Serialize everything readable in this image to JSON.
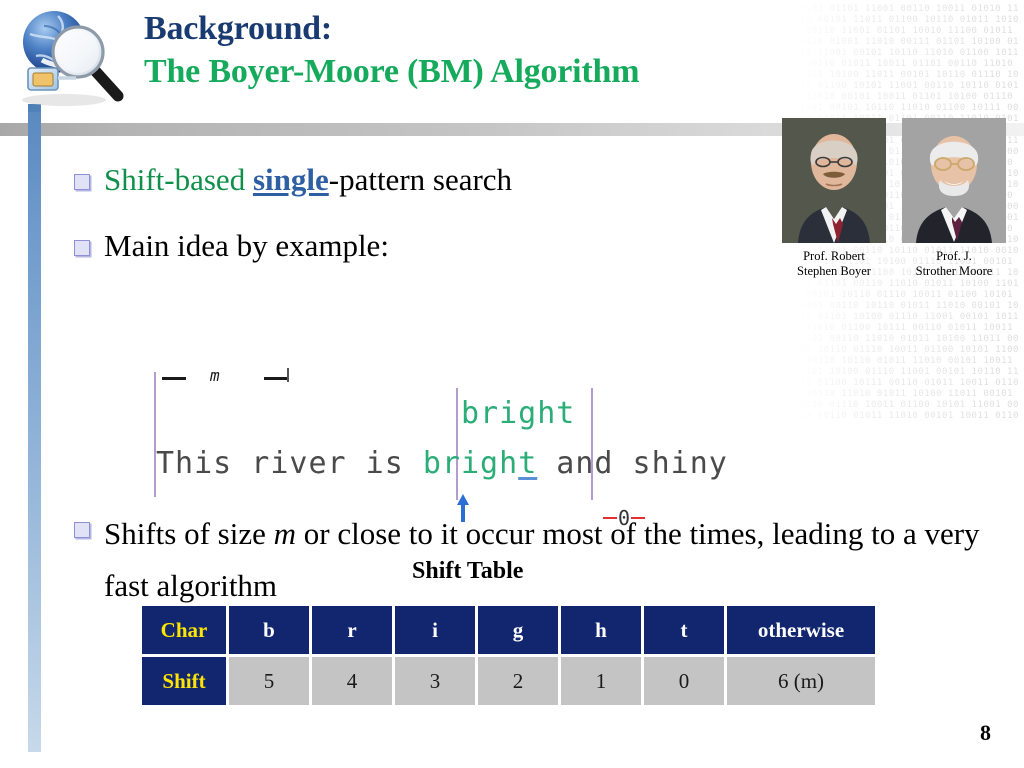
{
  "slide": {
    "title_line1": "Background:",
    "title_line2": "The Boyer-Moore (BM) Algorithm",
    "page_number": "8",
    "colors": {
      "title_dark_blue": "#1a3b72",
      "title_green": "#15aa5c",
      "bullet_green": "#0e8f4a",
      "link_blue": "#2e5fa3",
      "table_header_navy": "#11266e",
      "table_label_yellow": "#ffe400",
      "table_cell_gray": "#c4c4c4",
      "pattern_green": "#2bad78",
      "marker_purple": "#b49bd0",
      "arrow_blue": "#2b6fd6",
      "shift_red": "#e03030"
    }
  },
  "logo": {
    "name": "globe-magnifier-logo"
  },
  "bullets": [
    {
      "id": "bullet-shift-based",
      "parts": [
        {
          "text": "Shift-based ",
          "style": "green"
        },
        {
          "text": "single",
          "style": "link"
        },
        {
          "text": "-pattern search",
          "style": "plain"
        }
      ],
      "plain": "Shift-based single-pattern search"
    },
    {
      "id": "bullet-main-idea",
      "parts": [
        {
          "text": "Main idea by example:",
          "style": "plain"
        }
      ],
      "plain": "Main idea by example:"
    },
    {
      "id": "bullet-shifts-of-size",
      "parts": [
        {
          "text": "Shifts of size ",
          "style": "plain"
        },
        {
          "text": "m",
          "style": "italic"
        },
        {
          "text": " or close to it occur most of the times, leading to a very fast algorithm",
          "style": "plain"
        }
      ],
      "plain": "Shifts of size m or close to it occur most of the times, leading to a very fast algorithm"
    }
  ],
  "photos": [
    {
      "name": "photo-robert-boyer",
      "caption_line1": "Prof. Robert",
      "caption_line2": "Stephen Boyer"
    },
    {
      "name": "photo-j-strother-moore",
      "caption_line1": "Prof. J.",
      "caption_line2": "Strother Moore"
    }
  ],
  "example": {
    "text_prefix": "This river is ",
    "match_word": "bright",
    "match_last_char": "t",
    "text_suffix": " and shiny",
    "pattern_above": "bright",
    "span_label": "m",
    "shift_marker": "0",
    "text_full": "This river is bright and shiny"
  },
  "shift_table": {
    "label": "Shift Table",
    "row_headers": [
      "Char",
      "Shift"
    ],
    "chars": [
      "b",
      "r",
      "i",
      "g",
      "h",
      "t",
      "otherwise"
    ],
    "shifts": [
      "5",
      "4",
      "3",
      "2",
      "1",
      "0",
      "6 (m)"
    ]
  },
  "watermark": {
    "text": "10101 01101 11001 00110 10011 01010 11010 00101 11011 01100 10110 01011 10101 00110 11001 01101 10010 11100 01011 10110 01001 11010 00111 01101 10100 01110 11001 00101 10110 11010 01100 10111 00110 01011 10011 01101 00110 11010 01011 10100 11011 00101 10110 01110 10011 01100 10101 11001 00110 10110 01011 11010 00101 10011 01101 10100 01110 11001 00101 10110 11010 01100 10111 00110 01011 10011 01101 00110 11010 01011 10100 11011 00101 10110 01110 10011 01100 10101 11001 00110 10110 01011 11010 00101 10011 01101 10100 01110 11001 00101 10110 11010 01100 10111 00110 01011 10011 01101 00110 11010 01011 10100 11011 00101 10110 01110 10011 01100 10101 11001 00110 10110 01011 11010 00101 10011 01101 10100 01110 11001 00101 10110 11010 01100 10111 00110 01011 10011 01101 00110 11010 01011 10100 11011 00101 10110 01110 10011 01100 10101 11001 00110 10110 01011 11010 00101 10011 01101 10100 01110 11001 00101 10110 11010 01100 10111 00110 01011 10011 01101 00110 11010 01011 10100 11011 00101 10110 01110 10011 01100 10101 11001 00110 10110 01011 11010 00101 10011 01101 10100 01110 11001 00101 10110 11010 01100 10111 00110 01011 10011 01101 00110 11010 01011 10100 11011 00101 10110 01110 10011 01100 10101 11001 00110 10110 01011 11010 00101 10011 01101 10100 01110 11001 00101 10110 11010 01100 10111 00110 01011 10011 01101 00110 11010 01011 10100 11011 00101 10110 01110 10011 01100 10101 11001 00110 10110 01011 11010 00101 10011 01101"
  }
}
